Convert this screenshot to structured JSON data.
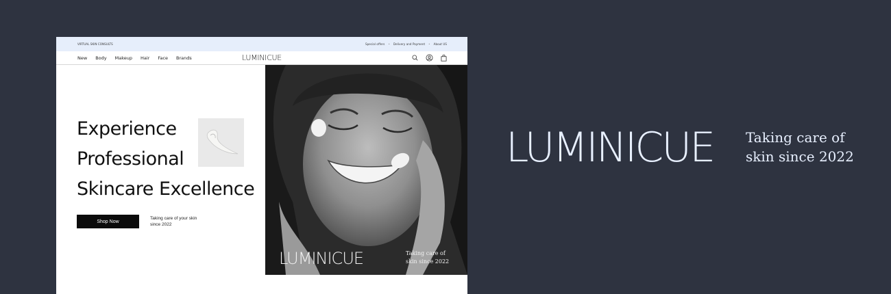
{
  "topbar": {
    "left": "VIRTUAL SKIN CONSULTS",
    "links": [
      "Special offers",
      "Delivery and Payment",
      "About US"
    ],
    "separator": "•"
  },
  "nav": {
    "links": [
      "New",
      "Body",
      "Makeup",
      "Hair",
      "Face",
      "Brands"
    ],
    "logo": "LUMINICUE",
    "icons": [
      "search-icon",
      "account-icon",
      "bag-icon"
    ]
  },
  "hero": {
    "headline_lines": [
      "Experience",
      "Professional",
      "Skincare Excellence"
    ],
    "cta_label": "Shop Now",
    "tagline": "Taking care of your skin since 2022",
    "photo_brand": "LUMINICUE",
    "photo_tagline": "Taking care of skin since 2022"
  },
  "brand": {
    "name": "LUMINICUE",
    "tagline_line1": "Taking care of",
    "tagline_line2": "skin since 2022"
  },
  "colors": {
    "background": "#2e3340",
    "topbar": "#e6eefb",
    "brand_text": "#e8f0ff",
    "cta": "#0b0b0b"
  }
}
